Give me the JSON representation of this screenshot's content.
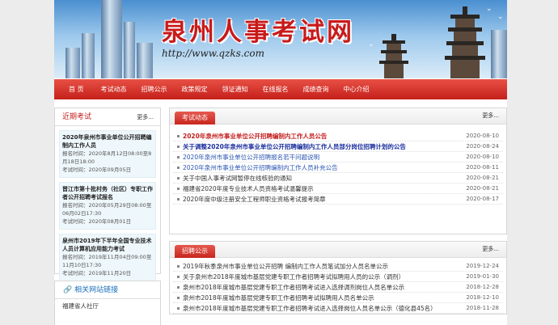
{
  "site": {
    "title": "泉州人事考试网",
    "url": "http://www.qzks.com"
  },
  "nav": {
    "items": [
      "首 页",
      "考试动态",
      "招聘公示",
      "政策规定",
      "领证通知",
      "在线报名",
      "成绩查询",
      "中心介绍"
    ]
  },
  "recent": {
    "title": "近期考试",
    "more": "更多...",
    "items": [
      {
        "title": "2020年泉州市事业单位公开招聘编制内工作人员",
        "reg": "报名时间：2020年8月12日08:00至8月18日18:00",
        "exam": "考试时间：2020年09月05日"
      },
      {
        "title": "晋江市第十批村务（社区）专职工作者公开招聘考试报名",
        "reg": "报名时间：2020年05月29日08:00至06月02日17:30",
        "exam": "考试时间：2020年08月01日"
      },
      {
        "title": "泉州市2019年下半年全国专业技术人员计算机应用能力考试",
        "reg": "报名时间：2019年11月04日09:00至11月10日17:30",
        "exam": "考试时间：2019年11月20日"
      }
    ]
  },
  "links": {
    "title": "相关网站链接",
    "items": [
      "福建省人社厅"
    ]
  },
  "news": {
    "tab": "考试动态",
    "more": "更多...",
    "items": [
      {
        "title": "2020年泉州市事业单位公开招聘编制内工作人员公告",
        "date": "2020-08-10",
        "style": "red"
      },
      {
        "title": "关于调整2020年泉州市事业单位公开招聘编制内工作人员部分岗位招聘计划的公告",
        "date": "2020-08-24",
        "style": "navy"
      },
      {
        "title": "2020年泉州市事业单位公开招聘报名若干问题说明",
        "date": "2020-08-10",
        "style": "blue"
      },
      {
        "title": "2020年泉州市事业单位公开招聘编制内工作人员补充公告",
        "date": "2020-08-11",
        "style": "blue"
      },
      {
        "title": "关于中国人事考试网暂停在线核验的通知",
        "date": "2020-08-21",
        "style": ""
      },
      {
        "title": "福建省2020年度专业技术人员资格考试温馨提示",
        "date": "2020-08-21",
        "style": ""
      },
      {
        "title": "2020年度中级注册安全工程师职业资格考试报考简章",
        "date": "2020-08-17",
        "style": ""
      }
    ]
  },
  "notices": {
    "tab": "招聘公示",
    "more": "更多...",
    "items": [
      {
        "title": "2019年秋季泉州市事业单位公开招聘  编制内工作人员笔试加分人员名单公示",
        "date": "2019-12-24"
      },
      {
        "title": "关于泉州市2018年度城市基层党建专职工作者招聘考试拟聘用人员的公示（调剂）",
        "date": "2019-01-30"
      },
      {
        "title": "泉州市2018年度城市基层党建专职工作者招聘考试进入选择调剂岗位人员名单公示",
        "date": "2018-12-28"
      },
      {
        "title": "泉州市2018年度城市基层党建专职工作者招聘考试拟聘用人员名单公示",
        "date": "2018-12-10"
      },
      {
        "title": "泉州市2018年度城市基层党建专职工作者招聘考试进入选择岗位人员名单公示（德化县45名）",
        "date": "2018-11-28"
      }
    ]
  }
}
